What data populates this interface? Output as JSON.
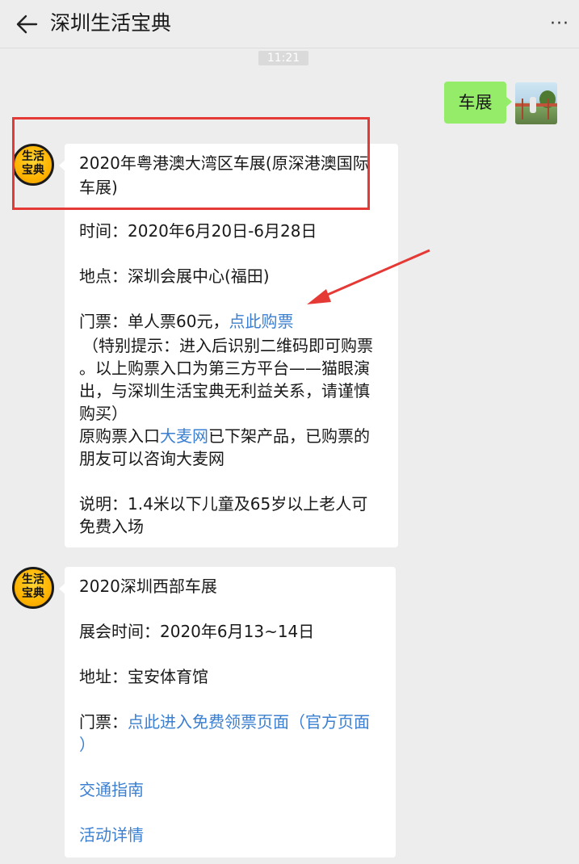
{
  "header": {
    "title": "深圳生活宝典",
    "more": "···"
  },
  "timestamp": "11:21",
  "sent_message": {
    "text": "车展"
  },
  "bot_avatar": {
    "line1": "生活",
    "line2": "宝典"
  },
  "message1": {
    "title_line1": "2020年粤港澳大湾区车展(原深港澳国际",
    "title_line2": "车展)",
    "time": "时间：2020年6月20日-6月28日",
    "place": "地点：深圳会展中心(福田)",
    "ticket_prefix": "门票：单人票60元，",
    "ticket_link": "点此购票",
    "tip_line1": "（特别提示：进入后识别二维码即可购票",
    "tip_line2": "。以上购票入口为第三方平台——猫眼演",
    "tip_line3": "出，与深圳生活宝典无利益关系，请谨慎",
    "tip_line4": "购买）",
    "orig_prefix": "原购票入口",
    "orig_link": "大麦网",
    "orig_suffix": "已下架产品，已购票的",
    "orig_line2": "朋友可以咨询大麦网",
    "note_line1": "说明：1.4米以下儿童及65岁以上老人可",
    "note_line2": "免费入场"
  },
  "message2": {
    "title": "2020深圳西部车展",
    "time": "展会时间：2020年6月13~14日",
    "address": "地址：宝安体育馆",
    "ticket_prefix": "门票：",
    "ticket_link_line1": "点此进入免费领票页面（官方页面",
    "ticket_link_line2": "）",
    "traffic_link": "交通指南",
    "details_link": "活动详情"
  },
  "colors": {
    "background": "#ededed",
    "sent_bubble": "#95ec69",
    "link": "#3a7fd1",
    "annotation": "#e53935"
  },
  "icons": [
    "back-arrow-icon",
    "more-icon",
    "bot-avatar-icon",
    "user-avatar-icon"
  ]
}
